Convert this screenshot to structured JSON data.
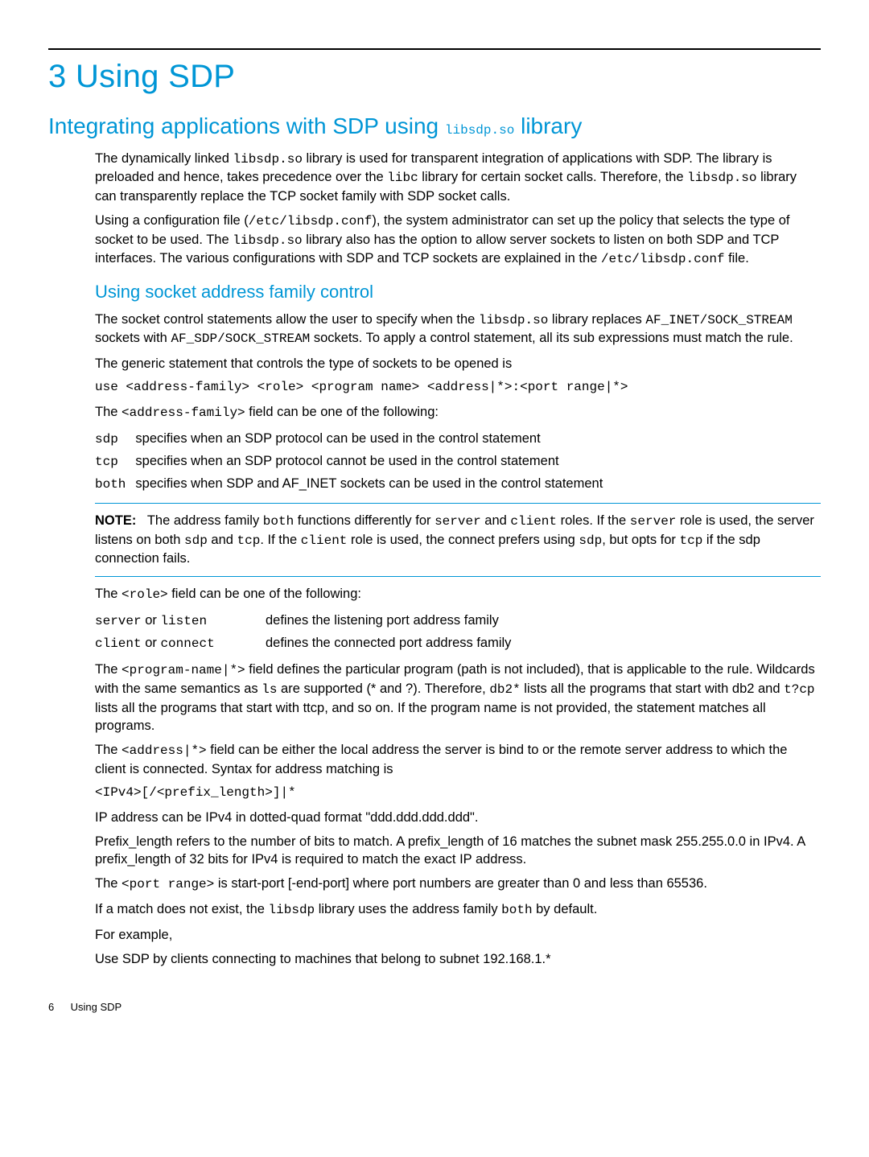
{
  "chapter": {
    "title": "3 Using SDP"
  },
  "section": {
    "title": "Integrating applications with SDP using libsdp.so library"
  },
  "para1_a": "The dynamically linked ",
  "para1_b": "libsdp.so",
  "para1_c": " library is used for transparent integration of applications with SDP. The library is preloaded and hence, takes precedence over the ",
  "para1_d": "libc",
  "para1_e": " library for certain socket calls. Therefore, the ",
  "para1_f": "libsdp.so",
  "para1_g": " library can transparently replace the TCP socket family with SDP socket calls.",
  "para2_a": "Using a configuration file (",
  "para2_b": "/etc/libsdp.conf",
  "para2_c": "), the system administrator can set up the policy that selects the type of socket to be used. The ",
  "para2_d": "libsdp.so",
  "para2_e": " library also has the option to allow server sockets to listen on both SDP and TCP interfaces. The various configurations with SDP and TCP sockets are explained in the ",
  "para2_f": "/etc/libsdp.conf",
  "para2_g": " file.",
  "subsection": {
    "title": "Using socket address family control"
  },
  "para3_a": "The socket control statements allow the user to specify when the ",
  "para3_b": "libsdp.so",
  "para3_c": " library replaces ",
  "para3_d": "AF_INET/SOCK_STREAM",
  "para3_e": " sockets with ",
  "para3_f": "AF_SDP/SOCK_STREAM",
  "para3_g": " sockets. To apply a control statement, all its sub expressions must match the rule.",
  "para4": "The generic statement that controls the type of sockets to be opened is",
  "code1": "use <address-family> <role> <program name> <address|*>:<port range|*>",
  "para5_a": "The ",
  "para5_b": "<address-family>",
  "para5_c": " field can be one of the following:",
  "af": [
    {
      "term": "sdp",
      "def": "specifies when an SDP protocol can be used in the control statement"
    },
    {
      "term": "tcp",
      "def": "specifies when an SDP protocol cannot be used in the control statement"
    },
    {
      "term": "both",
      "def": "specifies when SDP and AF_INET sockets can be used in the control statement"
    }
  ],
  "note": {
    "label": "NOTE:",
    "a": "The address family ",
    "b": "both",
    "c": " functions differently for ",
    "d": "server",
    "e": " and ",
    "f": "client",
    "g": " roles. If the ",
    "h": "server",
    "i": " role is used, the server listens on both ",
    "j": "sdp",
    "k": " and ",
    "l": "tcp",
    "m": ". If the ",
    "n": "client",
    "o": " role is used, the connect prefers using ",
    "p": "sdp",
    "q": ", but opts for ",
    "r": "tcp",
    "s": " if the sdp connection fails."
  },
  "para6_a": "The ",
  "para6_b": "<role>",
  "para6_c": " field can be one of the following:",
  "roles": [
    {
      "t1": "server",
      "or": " or ",
      "t2": "listen",
      "def": "defines the listening port address family"
    },
    {
      "t1": "client",
      "or": " or ",
      "t2": "connect",
      "def": "defines the connected port address family"
    }
  ],
  "para7_a": "The ",
  "para7_b": "<program-name|*>",
  "para7_c": " field defines the particular program (path is not included), that is applicable to the rule. Wildcards with the same semantics as ",
  "para7_d": "ls",
  "para7_e": " are supported (* and ?). Therefore, ",
  "para7_f": "db2*",
  "para7_g": " lists all the programs that start with db2 and ",
  "para7_h": "t?cp",
  "para7_i": " lists all the programs that start with ttcp, and so on. If the program name is not provided, the statement matches all programs.",
  "para8_a": "The ",
  "para8_b": "<address|*>",
  "para8_c": " field can be either the local address the server is bind to or the remote server address to which the client is connected. Syntax for address matching is",
  "code2": "<IPv4>[/<prefix_length>]|*",
  "para9": "IP address can be IPv4 in dotted-quad format \"ddd.ddd.ddd.ddd\".",
  "para10": "Prefix_length refers to the number of bits to match. A prefix_length of 16 matches the subnet mask 255.255.0.0 in IPv4. A prefix_length of 32 bits for IPv4 is required to match the exact IP address.",
  "para11_a": "The ",
  "para11_b": "<port range>",
  "para11_c": " is start-port [-end-port] where port numbers are greater than 0 and less than 65536.",
  "para12_a": "If a match does not exist, the ",
  "para12_b": "libsdp",
  "para12_c": " library uses the address family ",
  "para12_d": "both",
  "para12_e": " by default.",
  "para13": "For example,",
  "para14": "Use SDP by clients connecting to machines that belong to subnet 192.168.1.*",
  "footer": {
    "page": "6",
    "label": "Using SDP"
  }
}
